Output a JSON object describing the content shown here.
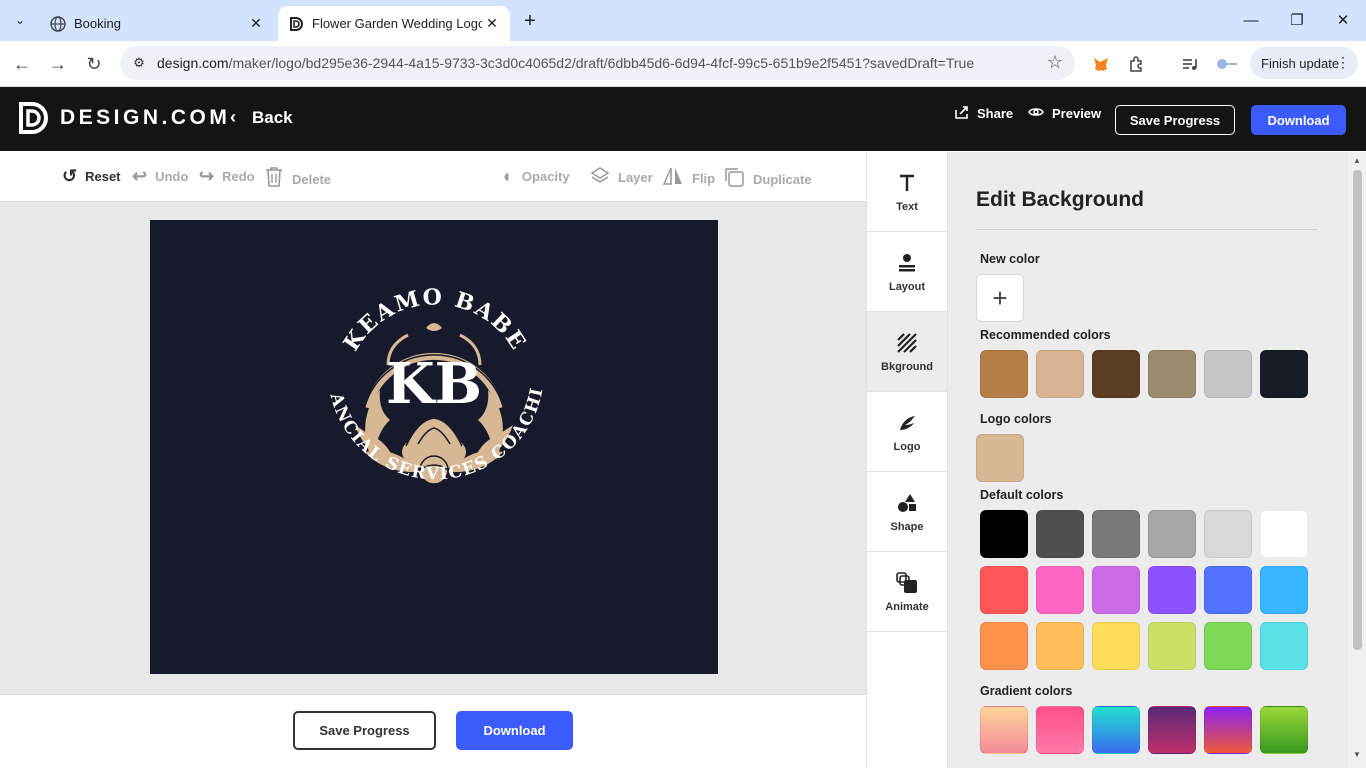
{
  "browser": {
    "tabs": [
      {
        "title": "Booking",
        "icon": "globe-icon"
      },
      {
        "title": "Flower Garden Wedding Logo |",
        "icon": "design-com-favicon"
      }
    ],
    "url_host": "design.com",
    "url_path": "/maker/logo/bd295e36-2944-4a15-9733-3c3d0c4065d2/draft/6dbb45d6-6d94-4fcf-99c5-651b9e2f5451?savedDraft=True",
    "finish_update": "Finish update"
  },
  "header": {
    "brand": "DESIGN.COM",
    "back": "Back",
    "share": "Share",
    "preview": "Preview",
    "save_progress": "Save Progress",
    "download": "Download"
  },
  "tools": {
    "reset": "Reset",
    "undo": "Undo",
    "redo": "Redo",
    "delete": "Delete",
    "opacity": "Opacity",
    "layer": "Layer",
    "flip": "Flip",
    "duplicate": "Duplicate"
  },
  "logo": {
    "top_text": "KEAMO BABE",
    "monogram": "KB",
    "bottom_text": "FINANCIAL SERVICES COACHING",
    "text_color": "#ffffff",
    "accent_color": "#d6b894",
    "background": "#171a2a"
  },
  "bottom": {
    "save_progress": "Save Progress",
    "download": "Download"
  },
  "sidebar": {
    "items": [
      {
        "label": "Text",
        "icon": "text-icon"
      },
      {
        "label": "Layout",
        "icon": "layout-icon"
      },
      {
        "label": "Bkground",
        "icon": "background-icon"
      },
      {
        "label": "Logo",
        "icon": "logo-icon"
      },
      {
        "label": "Shape",
        "icon": "shape-icon"
      },
      {
        "label": "Animate",
        "icon": "animate-icon"
      }
    ]
  },
  "panel": {
    "title": "Edit Background",
    "new_color": "New color",
    "recommended_colors": "Recommended colors",
    "logo_colors": "Logo colors",
    "default_colors": "Default colors",
    "gradient_colors": "Gradient colors",
    "recommended": [
      "#b57e45",
      "#d6b494",
      "#5b3f24",
      "#9a8a70",
      "#c3c6c8",
      "#171c24"
    ],
    "logo_palette": [
      "#d6b894"
    ],
    "defaults": [
      [
        "#000000",
        "#4f4f4f",
        "#787878",
        "#a6a6a6",
        "#d9d9d9",
        "#ffffff"
      ],
      [
        "#ff5757",
        "#ff66c4",
        "#cb6ce6",
        "#8c52ff",
        "#5271ff",
        "#38b6ff"
      ],
      [
        "#ff914d",
        "#ffbd59",
        "#ffde59",
        "#c9e265",
        "#7ed957",
        "#5ce1e6"
      ]
    ],
    "gradients": [
      [
        "#ffd59a",
        "#f28a9a"
      ],
      [
        "#ff4f8b",
        "#ff7aa8"
      ],
      [
        "#22e0d0",
        "#3a6cf0"
      ],
      [
        "#5a2a7a",
        "#c0306a"
      ],
      [
        "#8a22f0",
        "#f05a3a"
      ],
      [
        "#9ad83a",
        "#3a9a20"
      ]
    ]
  }
}
